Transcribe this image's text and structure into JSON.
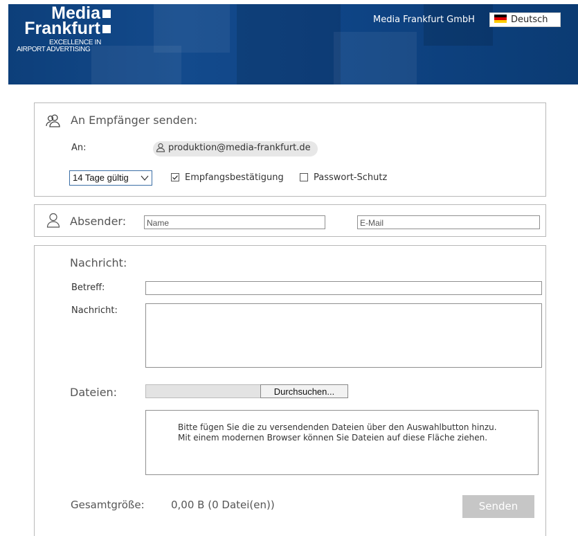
{
  "header": {
    "logo_line1": "Media",
    "logo_line2": "Frankfurt",
    "logo_tagline1": "EXCELLENCE IN",
    "logo_tagline2": "AIRPORT ADVERTISING",
    "company": "Media Frankfurt GmbH",
    "language": "Deutsch"
  },
  "recipient": {
    "title": "An Empfänger senden:",
    "to_label": "An:",
    "to_value": "produktion@media-frankfurt.de",
    "validity": "14 Tage gültig",
    "receipt_label": "Empfangsbestätigung",
    "receipt_checked": true,
    "password_label": "Passwort-Schutz",
    "password_checked": false
  },
  "sender": {
    "title": "Absender:",
    "name_placeholder": "Name",
    "email_placeholder": "E-Mail"
  },
  "message": {
    "title": "Nachricht:",
    "subject_label": "Betreff:",
    "body_label": "Nachricht:",
    "files_label": "Dateien:",
    "browse_label": "Durchsuchen...",
    "drop_line1": "Bitte fügen Sie die zu versendenden Dateien über den Auswahlbutton hinzu.",
    "drop_line2": "Mit einem modernen Browser können Sie Dateien auf diese Fläche ziehen.",
    "total_label": "Gesamtgröße:",
    "total_value": "0,00 B (0 Datei(en))",
    "send_label": "Senden"
  },
  "colors": {
    "header_bg": "#134a8c",
    "send_disabled": "#c6c6c6"
  },
  "icons": {
    "recipients": "users-icon",
    "sender": "user-icon",
    "chip": "user-icon",
    "select": "chevron-down-icon"
  }
}
